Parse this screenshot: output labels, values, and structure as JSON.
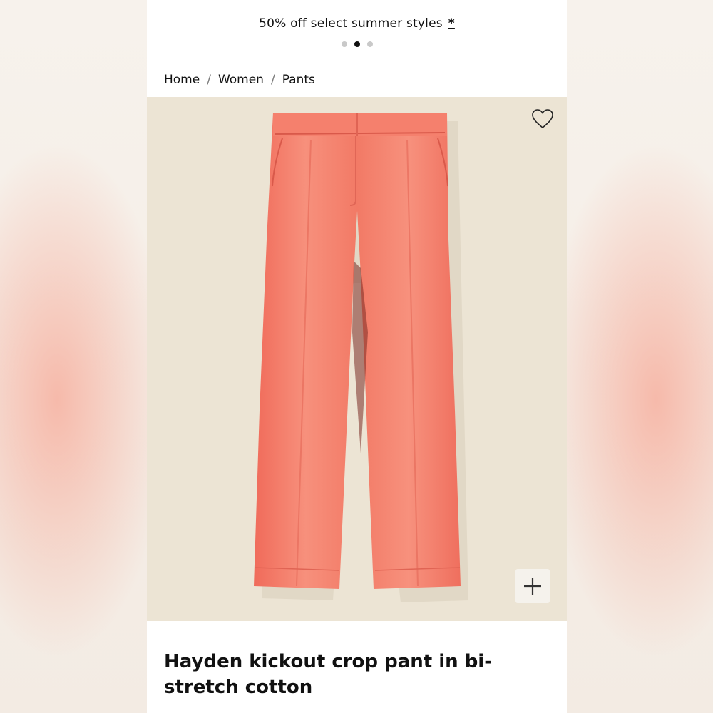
{
  "promo": {
    "text": "50% off select summer styles",
    "asterisk": "*",
    "carousel": {
      "count": 3,
      "active_index": 1
    }
  },
  "breadcrumb": {
    "items": [
      "Home",
      "Women",
      "Pants"
    ],
    "separator": "/"
  },
  "product": {
    "image_background": "#ece4d4",
    "garment_color": "#f58672",
    "title": "Hayden kickout crop pant in bi-stretch cotton"
  },
  "icons": {
    "wishlist": "heart-outline-icon",
    "zoom": "plus-icon"
  }
}
